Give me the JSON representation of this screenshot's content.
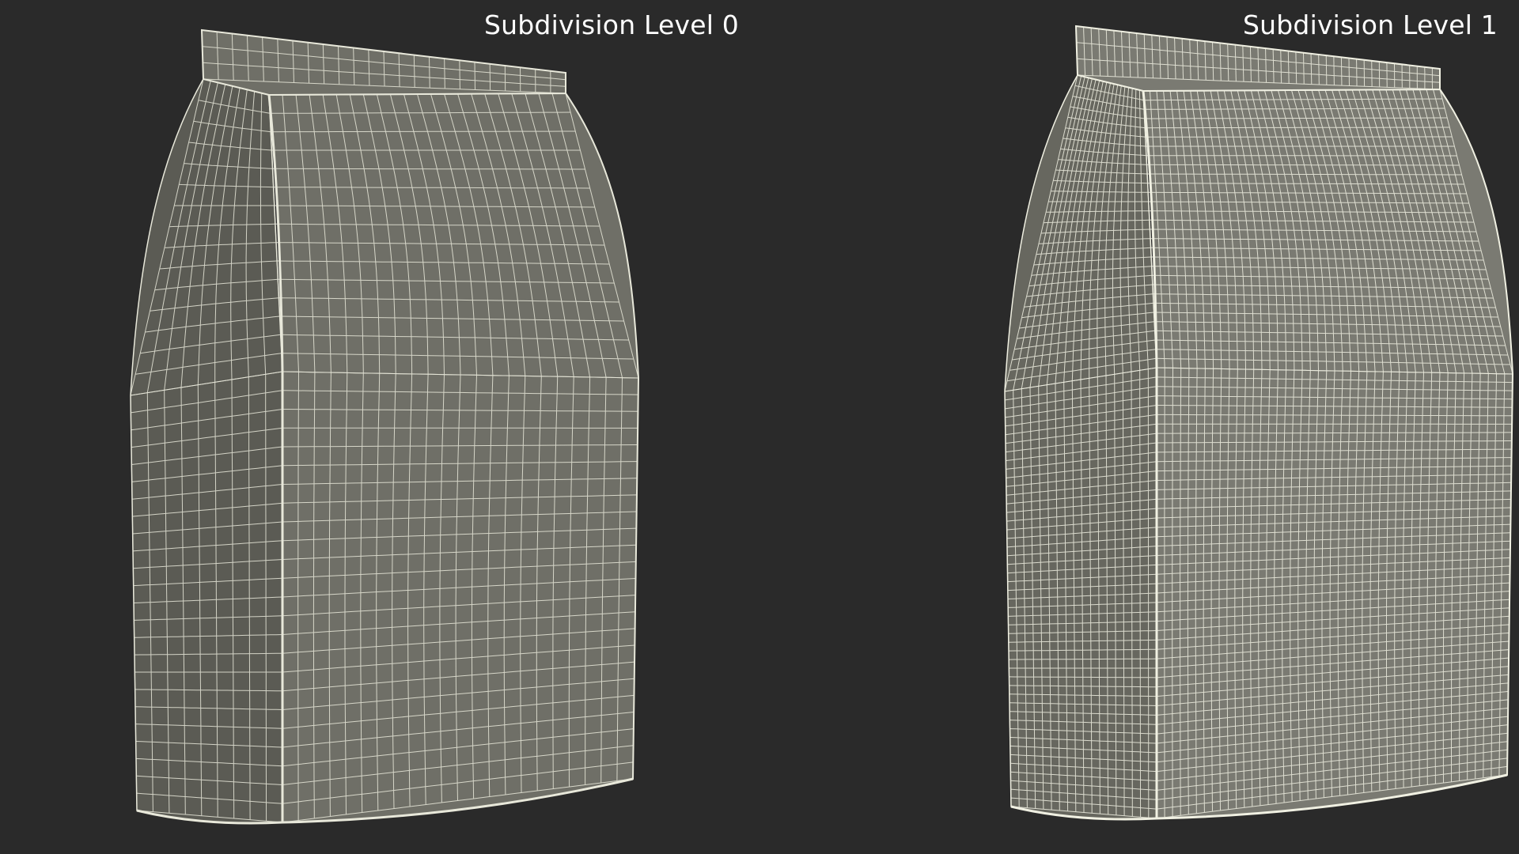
{
  "background_color": "#2a2a2a",
  "labels": {
    "left": "Subdivision Level 0",
    "right": "Subdivision Level 1"
  },
  "models": [
    {
      "name": "bag-subdivision-level-0",
      "fill": "#6f6f67",
      "shade": "#5b5b54",
      "wire": "#e8e8da",
      "grid_cols": 22,
      "grid_rows": 40,
      "side_cols": 9
    },
    {
      "name": "bag-subdivision-level-1",
      "fill": "#7a7a72",
      "shade": "#67675f",
      "wire": "#f0f0e2",
      "grid_cols": 44,
      "grid_rows": 80,
      "side_cols": 18
    }
  ]
}
